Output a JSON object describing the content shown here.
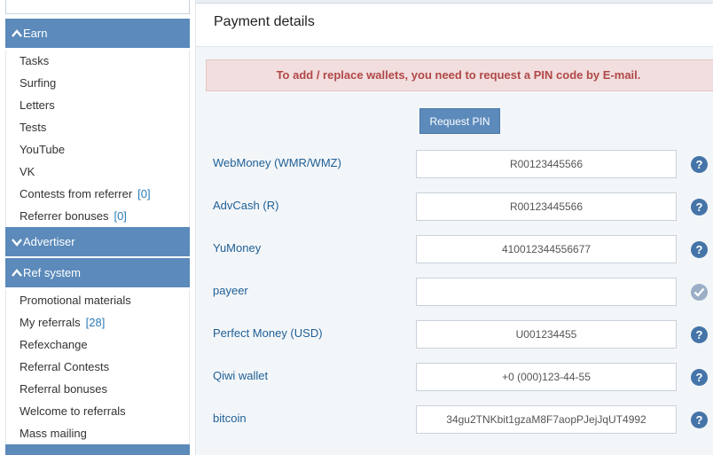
{
  "sidebar": {
    "earn_label": "Earn",
    "earn_items": [
      {
        "label": "Tasks",
        "count": ""
      },
      {
        "label": "Surfing",
        "count": ""
      },
      {
        "label": "Letters",
        "count": ""
      },
      {
        "label": "Tests",
        "count": ""
      },
      {
        "label": "YouTube",
        "count": ""
      },
      {
        "label": "VK",
        "count": ""
      },
      {
        "label": "Contests from referrer",
        "count": "[0]"
      },
      {
        "label": "Referrer bonuses",
        "count": "[0]"
      }
    ],
    "advertiser_label": "Advertiser",
    "ref_label": "Ref system",
    "ref_items": [
      {
        "label": "Promotional materials",
        "count": ""
      },
      {
        "label": "My referrals",
        "count": "[28]"
      },
      {
        "label": "Refexchange",
        "count": ""
      },
      {
        "label": "Referral Contests",
        "count": ""
      },
      {
        "label": "Referral bonuses",
        "count": ""
      },
      {
        "label": "Welcome to referrals",
        "count": ""
      },
      {
        "label": "Mass mailing",
        "count": ""
      }
    ]
  },
  "main": {
    "title": "Payment details",
    "alert": "To add / replace wallets, you need to request a PIN code by E-mail.",
    "request_pin_label": "Request PIN",
    "help_glyph": "?",
    "wallets": [
      {
        "label": "WebMoney (WMR/WMZ)",
        "value": "R00123445566",
        "status": "help"
      },
      {
        "label": "AdvCash (R)",
        "value": "R00123445566",
        "status": "help"
      },
      {
        "label": "YuMoney",
        "value": "410012344556677",
        "status": "help"
      },
      {
        "label": "payeer",
        "value": "",
        "status": "ok"
      },
      {
        "label": "Perfect Money (USD)",
        "value": "U001234455",
        "status": "help"
      },
      {
        "label": "Qiwi wallet",
        "value": "+0 (000)123-44-55",
        "status": "help"
      },
      {
        "label": "bitcoin",
        "value": "34gu2TNKbit1gzaM8F7aopPJejJqUT4992",
        "status": "help"
      }
    ]
  },
  "colors": {
    "accent": "#5b8abb",
    "alert_bg": "#f2dede",
    "alert_text": "#b04848",
    "label": "#1f5f96",
    "help": "#4574a8"
  },
  "icons": {
    "section_expanded": "chevron-up-icon",
    "section_collapsed": "chevron-down-icon",
    "help": "question-circle-icon",
    "verified": "check-circle-icon"
  }
}
